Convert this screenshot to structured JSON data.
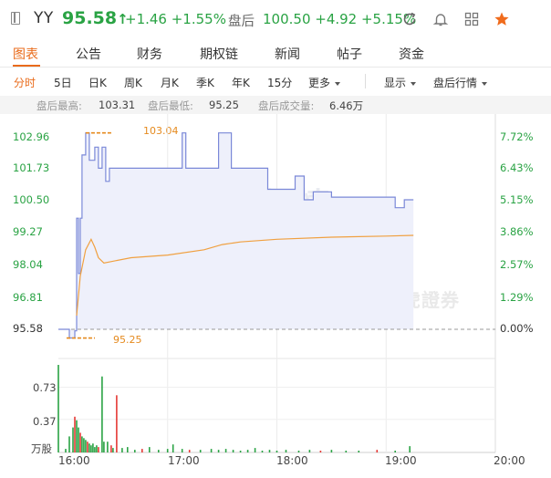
{
  "header": {
    "ticker": "YY",
    "price": "95.58",
    "price_arrow": "↑",
    "change": "+1.46 +1.55%",
    "after_hours_label": "盘后",
    "after_hours": "100.50 +4.92 +5.15%",
    "icons": [
      "refresh-icon",
      "bell-icon",
      "grid-icon",
      "star-icon"
    ],
    "star_color": "#f06b1c"
  },
  "tabs": [
    "图表",
    "公告",
    "财务",
    "期权链",
    "新闻",
    "帖子",
    "资金"
  ],
  "periods": [
    "分时",
    "5日",
    "日K",
    "周K",
    "月K",
    "季K",
    "年K",
    "15分",
    "更多"
  ],
  "period_right": [
    "显示",
    "盘后行情"
  ],
  "stats": {
    "high_label": "盘后最高:",
    "high": "103.31",
    "low_label": "盘后最低:",
    "low": "95.25",
    "vol_label": "盘后成交量:",
    "vol": "6.46万"
  },
  "watermark": "盘后行情",
  "brand": "老虎證券",
  "colors": {
    "up": "#2aa344",
    "down": "#e53935",
    "accent": "#e96b1b",
    "avg": "#f0a040",
    "price_line": "#7a88d8"
  },
  "chart_data": {
    "type": "line",
    "base_price": 95.58,
    "y_labels_left": [
      "102.96",
      "101.73",
      "100.50",
      "99.27",
      "98.04",
      "96.81",
      "95.58"
    ],
    "y_labels_right": [
      "7.72%",
      "6.43%",
      "5.15%",
      "3.86%",
      "2.57%",
      "1.29%",
      "0.00%"
    ],
    "x_labels": [
      "16:00",
      "17:00",
      "18:00",
      "19:00",
      "20:00"
    ],
    "volume_labels": [
      "0.73",
      "0.37",
      "万股"
    ],
    "high_annotation": "103.04",
    "low_annotation": "95.25",
    "series": [
      {
        "kind": "price",
        "x": [
          "16:00",
          "16:06",
          "16:09",
          "16:10",
          "16:11",
          "16:12",
          "16:13",
          "16:15",
          "16:17",
          "16:20",
          "16:22",
          "16:24",
          "16:26",
          "16:28",
          "16:35",
          "16:40",
          "16:55",
          "17:08",
          "17:10",
          "17:22",
          "17:28",
          "17:35",
          "17:50",
          "17:55",
          "18:00",
          "18:10",
          "18:15",
          "18:20",
          "18:25",
          "18:30",
          "18:45",
          "19:00",
          "19:05",
          "19:10",
          "19:15"
        ],
        "values": [
          95.58,
          95.25,
          95.52,
          99.8,
          97.7,
          99.8,
          102.2,
          103.04,
          102.0,
          102.5,
          101.7,
          102.5,
          101.2,
          101.7,
          101.7,
          101.7,
          101.7,
          103.04,
          101.7,
          101.7,
          103.04,
          101.7,
          101.7,
          100.9,
          100.9,
          101.4,
          100.5,
          100.8,
          100.8,
          100.6,
          100.6,
          100.6,
          100.2,
          100.5,
          100.5
        ]
      },
      {
        "kind": "avg",
        "x": [
          "16:10",
          "16:12",
          "16:15",
          "16:18",
          "16:20",
          "16:22",
          "16:25",
          "16:40",
          "17:00",
          "17:20",
          "17:30",
          "17:40",
          "18:00",
          "18:30",
          "19:00",
          "19:15"
        ],
        "values": [
          96.1,
          97.6,
          98.6,
          99.0,
          98.7,
          98.3,
          98.1,
          98.3,
          98.4,
          98.6,
          98.8,
          98.9,
          99.0,
          99.08,
          99.12,
          99.15
        ]
      }
    ],
    "volume": {
      "ylim": [
        0,
        1.0
      ],
      "bars": [
        {
          "x": "16:00",
          "v": 0.98,
          "c": "up"
        },
        {
          "x": "16:04",
          "v": 0.04,
          "c": "up"
        },
        {
          "x": "16:06",
          "v": 0.18,
          "c": "up"
        },
        {
          "x": "16:08",
          "v": 0.28,
          "c": "up"
        },
        {
          "x": "16:09",
          "v": 0.4,
          "c": "down"
        },
        {
          "x": "16:10",
          "v": 0.36,
          "c": "up"
        },
        {
          "x": "16:11",
          "v": 0.28,
          "c": "up"
        },
        {
          "x": "16:12",
          "v": 0.22,
          "c": "down"
        },
        {
          "x": "16:13",
          "v": 0.18,
          "c": "up"
        },
        {
          "x": "16:14",
          "v": 0.16,
          "c": "up"
        },
        {
          "x": "16:15",
          "v": 0.14,
          "c": "up"
        },
        {
          "x": "16:16",
          "v": 0.12,
          "c": "down"
        },
        {
          "x": "16:17",
          "v": 0.1,
          "c": "up"
        },
        {
          "x": "16:18",
          "v": 0.08,
          "c": "up"
        },
        {
          "x": "16:19",
          "v": 0.1,
          "c": "up"
        },
        {
          "x": "16:20",
          "v": 0.06,
          "c": "up"
        },
        {
          "x": "16:21",
          "v": 0.08,
          "c": "up"
        },
        {
          "x": "16:22",
          "v": 0.06,
          "c": "down"
        },
        {
          "x": "16:24",
          "v": 0.85,
          "c": "up"
        },
        {
          "x": "16:25",
          "v": 0.12,
          "c": "up"
        },
        {
          "x": "16:27",
          "v": 0.12,
          "c": "up"
        },
        {
          "x": "16:29",
          "v": 0.08,
          "c": "down"
        },
        {
          "x": "16:30",
          "v": 0.05,
          "c": "up"
        },
        {
          "x": "16:32",
          "v": 0.64,
          "c": "down"
        },
        {
          "x": "16:35",
          "v": 0.05,
          "c": "up"
        },
        {
          "x": "16:38",
          "v": 0.06,
          "c": "up"
        },
        {
          "x": "16:42",
          "v": 0.03,
          "c": "up"
        },
        {
          "x": "16:46",
          "v": 0.04,
          "c": "down"
        },
        {
          "x": "16:50",
          "v": 0.06,
          "c": "up"
        },
        {
          "x": "16:55",
          "v": 0.03,
          "c": "up"
        },
        {
          "x": "17:00",
          "v": 0.04,
          "c": "up"
        },
        {
          "x": "17:03",
          "v": 0.09,
          "c": "up"
        },
        {
          "x": "17:08",
          "v": 0.04,
          "c": "up"
        },
        {
          "x": "17:12",
          "v": 0.03,
          "c": "down"
        },
        {
          "x": "17:18",
          "v": 0.03,
          "c": "up"
        },
        {
          "x": "17:24",
          "v": 0.04,
          "c": "up"
        },
        {
          "x": "17:28",
          "v": 0.03,
          "c": "up"
        },
        {
          "x": "17:32",
          "v": 0.04,
          "c": "up"
        },
        {
          "x": "17:36",
          "v": 0.03,
          "c": "up"
        },
        {
          "x": "17:40",
          "v": 0.02,
          "c": "up"
        },
        {
          "x": "17:44",
          "v": 0.03,
          "c": "up"
        },
        {
          "x": "17:48",
          "v": 0.05,
          "c": "up"
        },
        {
          "x": "17:52",
          "v": 0.02,
          "c": "up"
        },
        {
          "x": "17:56",
          "v": 0.03,
          "c": "up"
        },
        {
          "x": "18:00",
          "v": 0.02,
          "c": "up"
        },
        {
          "x": "18:05",
          "v": 0.03,
          "c": "up"
        },
        {
          "x": "18:12",
          "v": 0.02,
          "c": "up"
        },
        {
          "x": "18:18",
          "v": 0.03,
          "c": "up"
        },
        {
          "x": "18:24",
          "v": 0.02,
          "c": "down"
        },
        {
          "x": "18:30",
          "v": 0.03,
          "c": "up"
        },
        {
          "x": "18:38",
          "v": 0.02,
          "c": "up"
        },
        {
          "x": "18:45",
          "v": 0.02,
          "c": "up"
        },
        {
          "x": "18:55",
          "v": 0.03,
          "c": "down"
        },
        {
          "x": "19:05",
          "v": 0.02,
          "c": "up"
        },
        {
          "x": "19:13",
          "v": 0.07,
          "c": "up"
        }
      ]
    },
    "ylim": [
      95.58,
      103.5
    ]
  }
}
